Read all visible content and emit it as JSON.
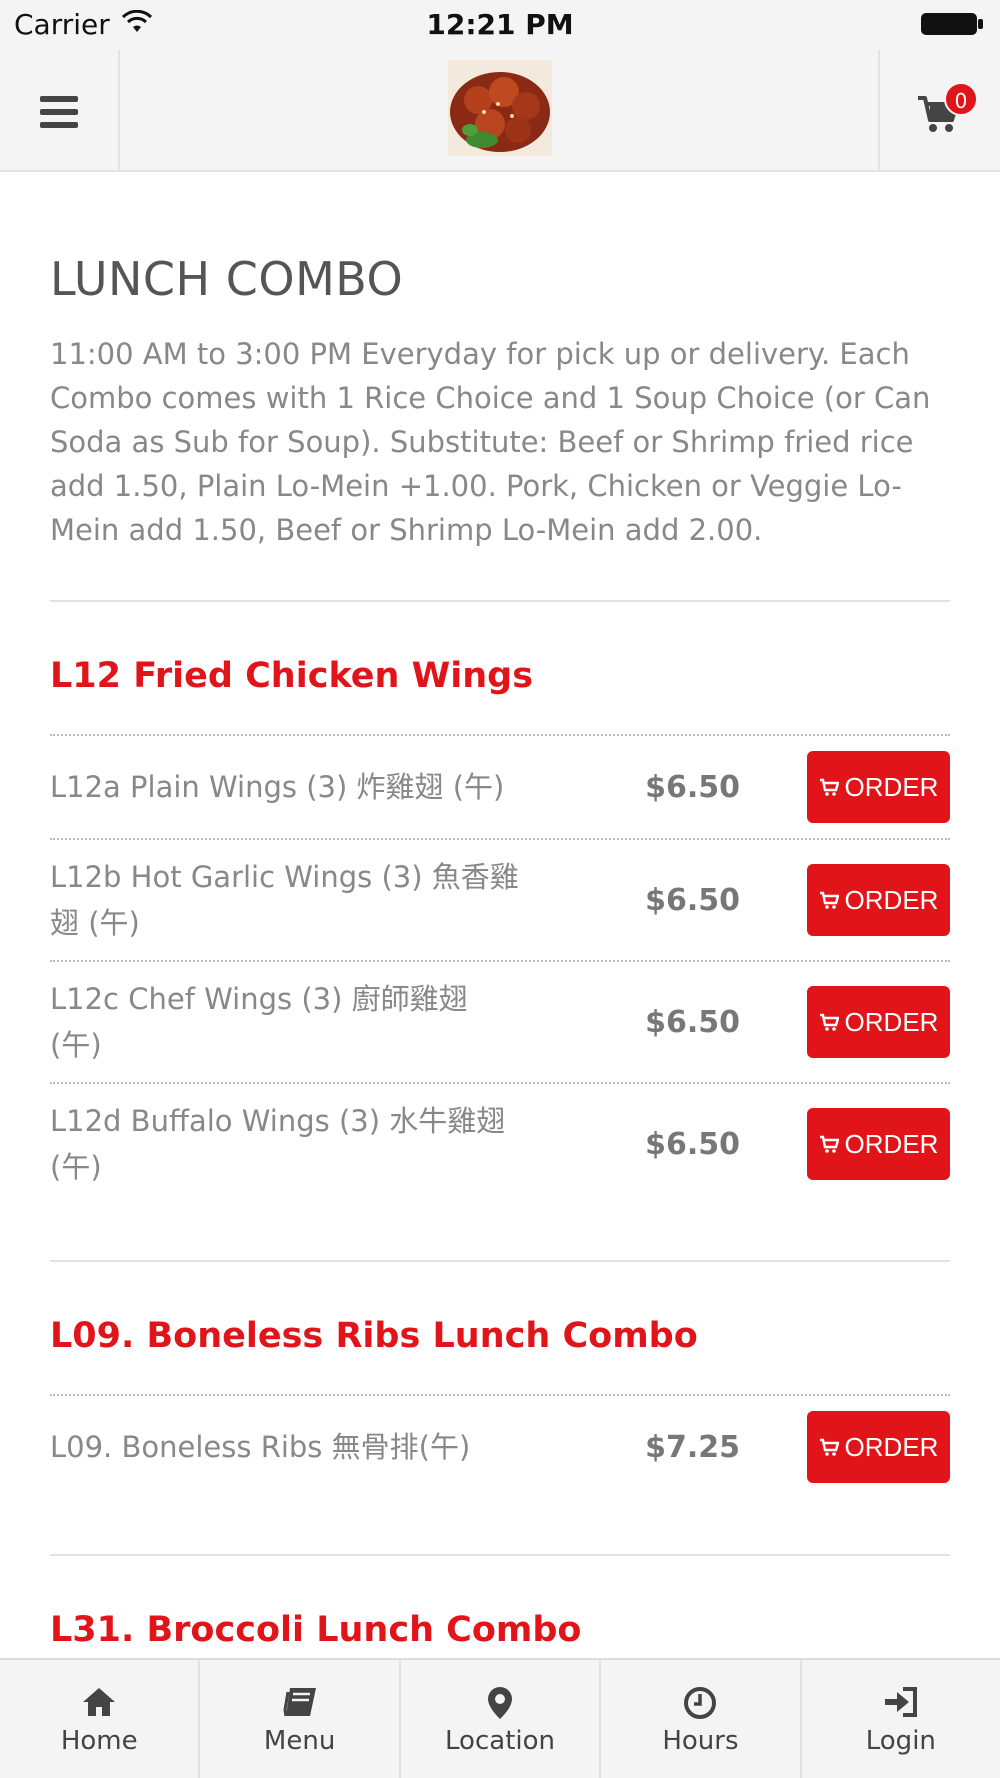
{
  "status_bar": {
    "carrier": "Carrier",
    "time": "12:21 PM"
  },
  "header": {
    "menu_icon": "hamburger-menu-icon",
    "logo_icon": "food-photo-logo",
    "cart_icon": "shopping-cart-icon",
    "cart_count": "0"
  },
  "page": {
    "title": "LUNCH COMBO",
    "description": "11:00 AM to 3:00 PM Everyday for pick up or delivery. Each Combo comes with 1 Rice Choice and 1 Soup Choice (or Can Soda as Sub for Soup). Substitute: Beef or Shrimp fried rice add 1.50, Plain Lo-Mein +1.00. Pork, Chicken or Veggie Lo-Mein add 1.50, Beef or Shrimp Lo-Mein add 2.00."
  },
  "sections": [
    {
      "title": "L12 Fried Chicken Wings",
      "items": [
        {
          "name": "L12a Plain Wings (3) 炸雞翅 (午)",
          "price": "$6.50",
          "order_label": "ORDER"
        },
        {
          "name": "L12b Hot Garlic Wings (3) 魚香雞翅 (午)",
          "price": "$6.50",
          "order_label": "ORDER"
        },
        {
          "name": "L12c Chef Wings (3) 廚師雞翅 (午)",
          "price": "$6.50",
          "order_label": "ORDER"
        },
        {
          "name": "L12d Buffalo Wings (3) 水牛雞翅 (午)",
          "price": "$6.50",
          "order_label": "ORDER"
        }
      ]
    },
    {
      "title": "L09. Boneless Ribs Lunch Combo",
      "items": [
        {
          "name": "L09. Boneless Ribs 無骨排(午)",
          "price": "$7.25",
          "order_label": "ORDER"
        }
      ]
    },
    {
      "title": "L31. Broccoli Lunch Combo",
      "items": []
    }
  ],
  "colors": {
    "accent": "#e1141a",
    "header_bg": "#f4f4f4",
    "text_muted": "#888888"
  },
  "tab_bar": {
    "tabs": [
      {
        "label": "Home",
        "icon": "home-icon"
      },
      {
        "label": "Menu",
        "icon": "book-icon"
      },
      {
        "label": "Location",
        "icon": "map-pin-icon"
      },
      {
        "label": "Hours",
        "icon": "clock-icon"
      },
      {
        "label": "Login",
        "icon": "sign-in-icon"
      }
    ]
  }
}
